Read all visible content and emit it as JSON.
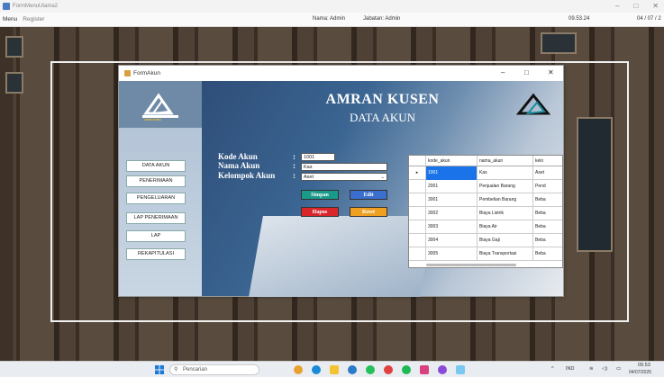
{
  "window": {
    "title": "FormMenuUtama2"
  },
  "menubar": {
    "items": [
      "Menu",
      "Register"
    ],
    "nama": "Nama: Admin",
    "jabatan": "Jabatan: Admin",
    "time": "09.53.24",
    "date": "04 / 07 / 2"
  },
  "dialog": {
    "title": "FormAkun",
    "heading": "AMRAN KUSEN",
    "subheading": "DATA AKUN",
    "logo_text": "AMRAN KUSEN",
    "sidebar": [
      "DATA AKUN",
      "PENERIMAAN",
      "PENGELUARAN",
      "LAP PENERIMAAN",
      "LAP",
      "REKAPITULASI"
    ],
    "form": {
      "kode_label": "Kode Akun",
      "nama_label": "Nama Akun",
      "kelompok_label": "Kelompok Akun",
      "kode_value": "1001",
      "nama_value": "Kas",
      "kelompok_value": "Aset"
    },
    "buttons": {
      "simpan": "Simpan",
      "edit": "Edit",
      "hapus": "Hapus",
      "reset": "Reset"
    },
    "grid": {
      "columns": [
        "kode_akun",
        "nama_akun",
        "kelo"
      ],
      "rows": [
        [
          "1001",
          "Kas",
          "Aset"
        ],
        [
          "2001",
          "Penjualan Barang",
          "Pend"
        ],
        [
          "3001",
          "Pembelian Barang",
          "Beba"
        ],
        [
          "3002",
          "Biaya Listrik",
          "Beba"
        ],
        [
          "3003",
          "Biaya Air",
          "Beba"
        ],
        [
          "3004",
          "Biaya Gaji",
          "Beba"
        ],
        [
          "3005",
          "Biaya Transportasi",
          "Beba"
        ]
      ]
    }
  },
  "taskbar": {
    "search_placeholder": "Pencarian",
    "lang": "IND",
    "time": "09.53",
    "date": "04/07/2025"
  },
  "colors": {
    "selected_row": "#1a73e8",
    "simpan": "#1a9a8a",
    "edit": "#3a6fd0",
    "hapus": "#d9262b",
    "reset": "#f0a020"
  }
}
